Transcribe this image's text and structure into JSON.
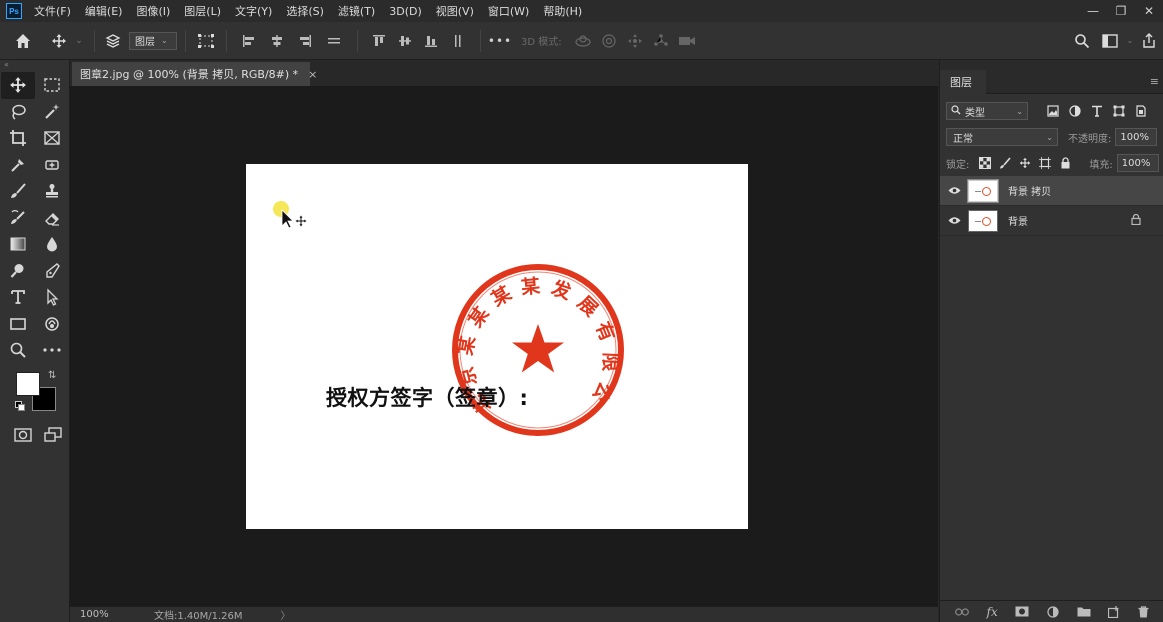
{
  "app": {
    "logo": "Ps"
  },
  "menu": [
    "文件(F)",
    "编辑(E)",
    "图像(I)",
    "图层(L)",
    "文字(Y)",
    "选择(S)",
    "滤镜(T)",
    "3D(D)",
    "视图(V)",
    "窗口(W)",
    "帮助(H)"
  ],
  "options": {
    "layer_select": "图层",
    "mode_3d": "3D 模式:",
    "more": "•••"
  },
  "document": {
    "tab_title": "图章2.jpg @ 100% (背景 拷贝, RGB/8#) *",
    "tab_close": "×",
    "sign_text": "授权方签字（签章）:",
    "seal_text": "北京某某某某发展有限公司",
    "seal_color": "#e0361b"
  },
  "status": {
    "zoom": "100%",
    "doc_size": "文档:1.40M/1.26M",
    "arrow": "〉"
  },
  "panel": {
    "tab": "图层",
    "kind_filter": "类型",
    "blend_mode": "正常",
    "opacity_label": "不透明度:",
    "opacity_value": "100%",
    "lock_label": "锁定:",
    "fill_label": "填充:",
    "fill_value": "100%",
    "layers": [
      {
        "name": "背景 拷贝",
        "selected": true
      },
      {
        "name": "背景",
        "selected": false,
        "locked": true
      }
    ],
    "fx_label": "fx"
  },
  "colors": {
    "accent": "#31a8ff",
    "foreground": "#ffffff",
    "background": "#000000"
  }
}
